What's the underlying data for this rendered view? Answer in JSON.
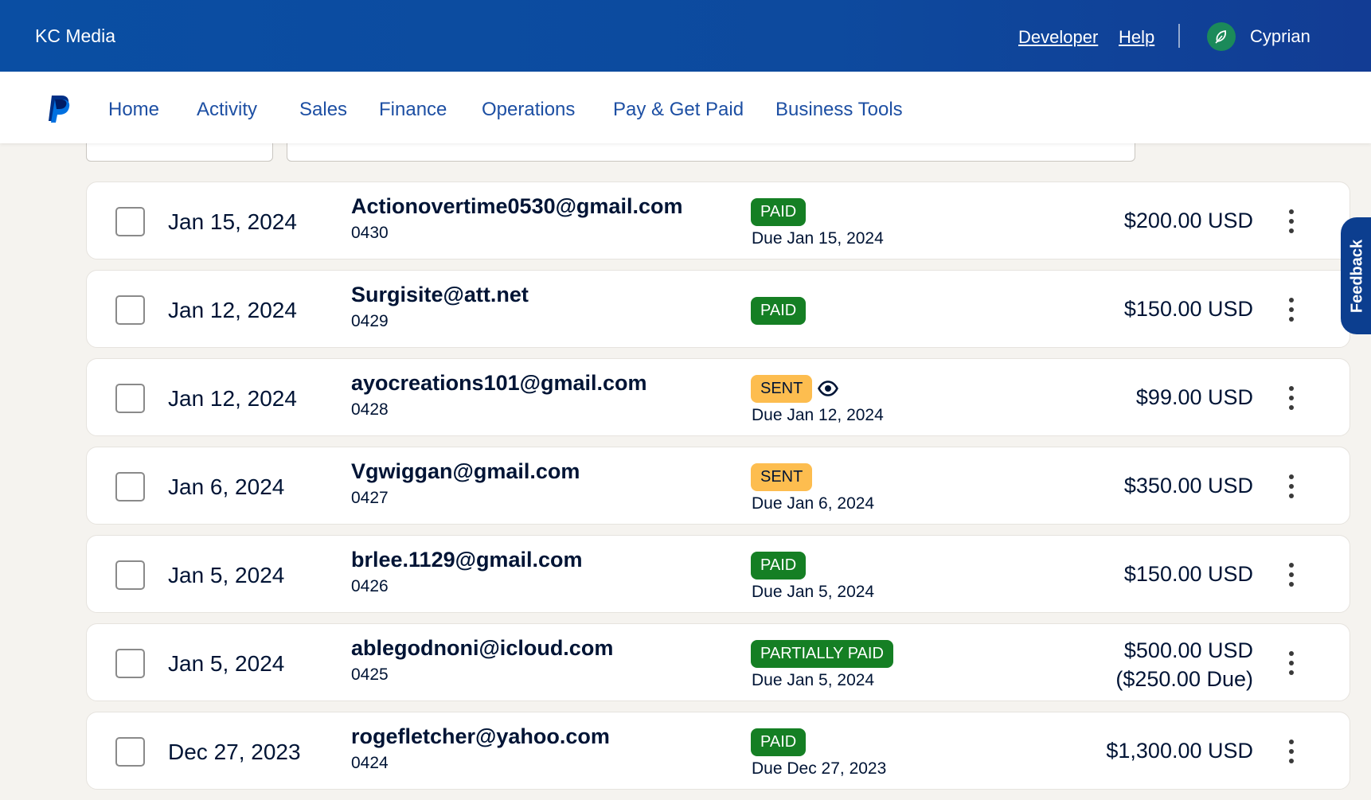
{
  "topbar": {
    "brand": "KC Media",
    "links": {
      "developer": "Developer",
      "help": "Help"
    },
    "user_name": "Cyprian"
  },
  "nav": {
    "items": [
      "Home",
      "Activity",
      "Sales",
      "Finance",
      "Operations",
      "Pay & Get Paid",
      "Business Tools"
    ]
  },
  "invoices": [
    {
      "date": "Jan 15, 2024",
      "email": "Actionovertime0530@gmail.com",
      "number": "0430",
      "status": "PAID",
      "due": "Due Jan 15, 2024",
      "amount": "$200.00 USD"
    },
    {
      "date": "Jan 12, 2024",
      "email": "Surgisite@att.net",
      "number": "0429",
      "status": "PAID",
      "due": "",
      "amount": "$150.00 USD"
    },
    {
      "date": "Jan 12, 2024",
      "email": "ayocreations101@gmail.com",
      "number": "0428",
      "status": "SENT",
      "viewed_icon": "eye-icon",
      "due": "Due Jan 12, 2024",
      "amount": "$99.00 USD"
    },
    {
      "date": "Jan 6, 2024",
      "email": "Vgwiggan@gmail.com",
      "number": "0427",
      "status": "SENT",
      "due": "Due Jan 6, 2024",
      "amount": "$350.00 USD"
    },
    {
      "date": "Jan 5, 2024",
      "email": "brlee.1129@gmail.com",
      "number": "0426",
      "status": "PAID",
      "due": "Due Jan 5, 2024",
      "amount": "$150.00 USD"
    },
    {
      "date": "Jan 5, 2024",
      "email": "ablegodnoni@icloud.com",
      "number": "0425",
      "status": "PARTIALLY PAID",
      "due": "Due Jan 5, 2024",
      "amount": "$500.00 USD",
      "amount_due": "($250.00 Due)"
    },
    {
      "date": "Dec 27, 2023",
      "email": "rogefletcher@yahoo.com",
      "number": "0424",
      "status": "PAID",
      "due": "Due Dec 27, 2023",
      "amount": "$1,300.00 USD"
    }
  ],
  "feedback": {
    "label": "Feedback"
  },
  "colors": {
    "topbar": "#0d4a9e",
    "nav_link": "#1d4fa3",
    "paid_badge": "#157f24",
    "sent_badge": "#fdbd4f",
    "feedback_tab": "#0c3e8f",
    "page_bg": "#f5f3ef"
  }
}
